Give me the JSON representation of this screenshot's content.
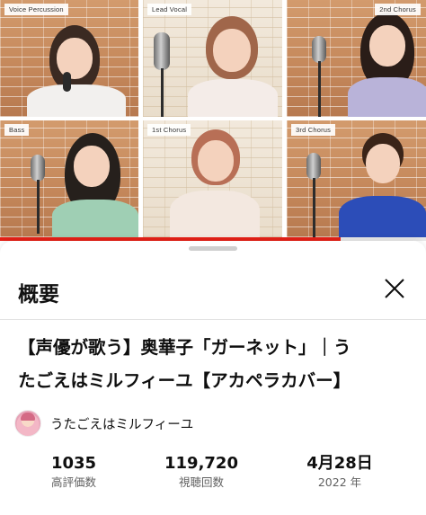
{
  "video": {
    "tiles": [
      {
        "label": "Voice Percussion"
      },
      {
        "label": "Lead Vocal"
      },
      {
        "label": "2nd Chorus"
      },
      {
        "label": "Bass"
      },
      {
        "label": "1st Chorus"
      },
      {
        "label": "3rd Chorus"
      }
    ],
    "progress_fraction": 0.8
  },
  "sheet": {
    "title": "概要",
    "close_icon": "close-icon",
    "video_title_line1": "【声優が歌う】奥華子「ガーネット」｜う",
    "video_title_line2": "たごえはミルフィーユ【アカペラカバー】",
    "channel_name": "うたごえはミルフィーユ",
    "stats": [
      {
        "value": "1035",
        "label": "高評価数"
      },
      {
        "value": "119,720",
        "label": "視聴回数"
      },
      {
        "value": "4月28日",
        "label": "2022 年"
      }
    ]
  },
  "colors": {
    "progress": "#e62117",
    "text_primary": "#0f0f0f",
    "text_secondary": "#606060"
  }
}
